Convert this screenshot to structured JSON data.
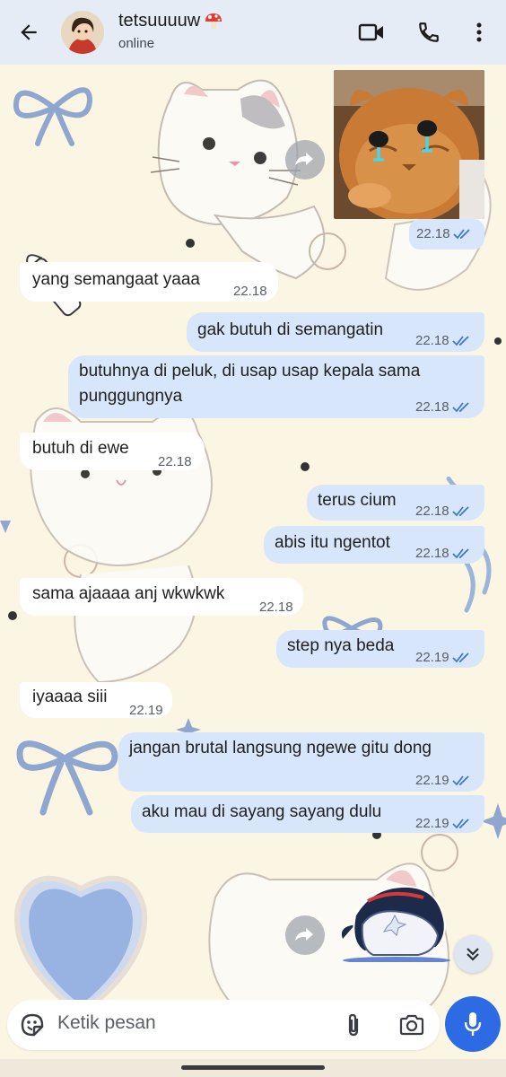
{
  "header": {
    "contact_name": "tetsuuuuw",
    "status": "online",
    "icons": [
      "back-arrow-icon",
      "video-call-icon",
      "voice-call-icon",
      "more-vert-icon"
    ]
  },
  "messages": [
    {
      "dir": "out",
      "type": "image",
      "time": "22.18",
      "read": true
    },
    {
      "dir": "in",
      "text": "yang semangaat yaaa",
      "time": "22.18"
    },
    {
      "dir": "out",
      "text": "gak butuh di semangatin",
      "time": "22.18",
      "read": true
    },
    {
      "dir": "out",
      "text_line1": "butuhnya di peluk, di usap usap kepala sama",
      "text_line2": "punggungnya",
      "time": "22.18",
      "read": true
    },
    {
      "dir": "in",
      "text": "butuh di ewe",
      "time": "22.18"
    },
    {
      "dir": "out",
      "text": "terus cium",
      "time": "22.18",
      "read": true
    },
    {
      "dir": "out",
      "text": "abis itu ngentot",
      "time": "22.18",
      "read": true
    },
    {
      "dir": "in",
      "text": "sama ajaaaa anj wkwkwk",
      "time": "22.18"
    },
    {
      "dir": "out",
      "text": "step nya beda",
      "time": "22.19",
      "read": true
    },
    {
      "dir": "in",
      "text": "iyaaaa siii",
      "time": "22.19"
    },
    {
      "dir": "out",
      "text": "jangan brutal langsung ngewe gitu dong",
      "time": "22.19",
      "read": true
    },
    {
      "dir": "out",
      "text": "aku mau di sayang sayang dulu",
      "time": "22.19",
      "read": true
    },
    {
      "dir": "out",
      "type": "sticker"
    }
  ],
  "composer": {
    "placeholder": "Ketik pesan"
  },
  "colors": {
    "header_bg": "#e6ecf6",
    "outgoing_bubble": "#d8e6fb",
    "incoming_bubble": "#ffffff",
    "read_ticks": "#3a78d6",
    "mic_button": "#2d6be4"
  }
}
